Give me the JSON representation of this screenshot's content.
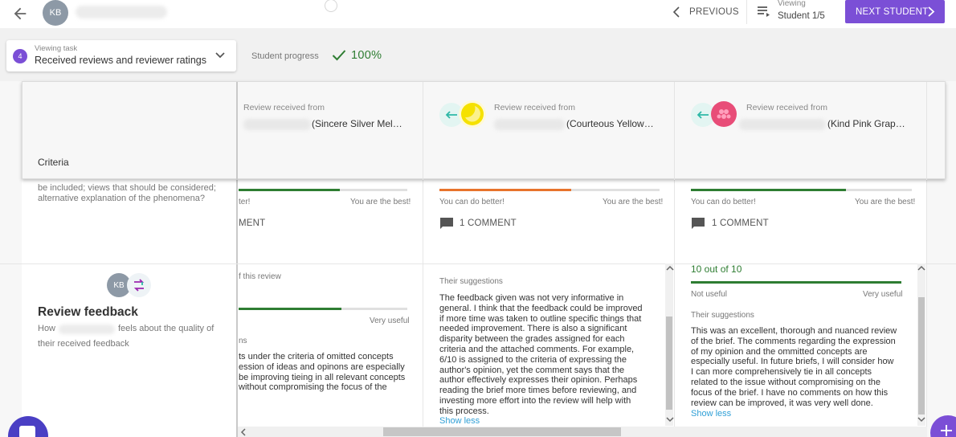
{
  "topbar": {
    "avatar_initials": "KB",
    "previous_label": "PREVIOUS",
    "viewing_label": "Viewing",
    "student_position": "Student 1/5",
    "next_label": "NEXT STUDENT"
  },
  "toolbar": {
    "task_number": "4",
    "task_small_label": "Viewing task",
    "task_name": "Received reviews and reviewer ratings",
    "progress_label": "Student progress",
    "progress_value": "100%"
  },
  "criteria_column": {
    "header": "Criteria",
    "criterion_text_line1": "be included; views that should be considered;",
    "criterion_text_line2": "alternative explanation of the phenomena?",
    "avatar_initials": "KB",
    "feedback_title": "Review feedback",
    "feedback_desc_prefix": "How",
    "feedback_desc_suffix": "feels about the quality of",
    "feedback_desc_line2": "their received feedback"
  },
  "reviews": [
    {
      "received_from": "Review received from",
      "reviewer_name": "(Sincere Silver Mel…",
      "bar_left": "ter!",
      "bar_right": "You are the best!",
      "bar_fraction": 0.6,
      "comment": "MENT",
      "rating_partial": "f this review",
      "rating_right": "Very useful",
      "suggestions_partial": "ns",
      "text_lines": [
        "ts under the criteria of omitted concepts",
        "ession of ideas and opinons are especially",
        "be improving tieing in all relevant concepts",
        "without compromising the focus of the"
      ]
    },
    {
      "received_from": "Review received from",
      "reviewer_name": "(Courteous Yellow…",
      "bar_left": "You can do better!",
      "bar_right": "You are the best!",
      "bar_fraction": 0.6,
      "bar_color": "#e8742c",
      "comment": "1 COMMENT",
      "suggestions_label": "Their suggestions",
      "text_lines": [
        "The feedback given was not very informative in",
        "general. I think that the feedback could be improved",
        "if more time was taken to outline specific things that",
        "needed improvement. There is also a significant",
        "disparity between the grades assigned for each",
        "criteria and the attached comments. For example,",
        "6/10 is assigned to the criteria of expressing the",
        "author's opinion, yet the comment says that the",
        "author effectively expresses their opinion. Perhaps",
        "reading the brief more times before reviewing, and",
        "investing more effort into the review will help with",
        "this process."
      ],
      "show_less": "Show less"
    },
    {
      "received_from": "Review received from",
      "reviewer_name": "(Kind Pink Grap…",
      "bar_left": "You can do better!",
      "bar_right": "You are the best!",
      "bar_fraction": 0.7,
      "comment": "1 COMMENT",
      "rating_value": "10 out of 10",
      "rating_left": "Not useful",
      "rating_right": "Very useful",
      "suggestions_label": "Their suggestions",
      "text_lines": [
        "This was an excellent, thorough and nuanced review",
        "of the brief. The comments regarding the expression",
        "of my opinion and the ommitted concepts are",
        "especially useful. In future briefs, I will consider how",
        "I can more comprehensively tie in all concepts",
        "related to the issue without compromising on the",
        "focus of the brief. I have no comments on how this",
        "review can be improved, it was very well done."
      ],
      "show_less": "Show less"
    }
  ],
  "colors": {
    "accent": "#7b4fd6",
    "success": "#2e7d32",
    "bar_green": "#2e7d32",
    "bar_orange": "#e8742c",
    "link": "#2f9fd6"
  },
  "icons": [
    "back-arrow-icon",
    "chevron-left-icon",
    "list-icon",
    "chevron-right-icon",
    "chevron-down-icon",
    "check-icon",
    "arrow-left-icon",
    "moon-avatar-icon",
    "raspberry-avatar-icon",
    "comment-icon",
    "share-arrow-icon",
    "scroll-left-icon",
    "scroll-up-icon",
    "scroll-down-icon",
    "add-icon"
  ]
}
